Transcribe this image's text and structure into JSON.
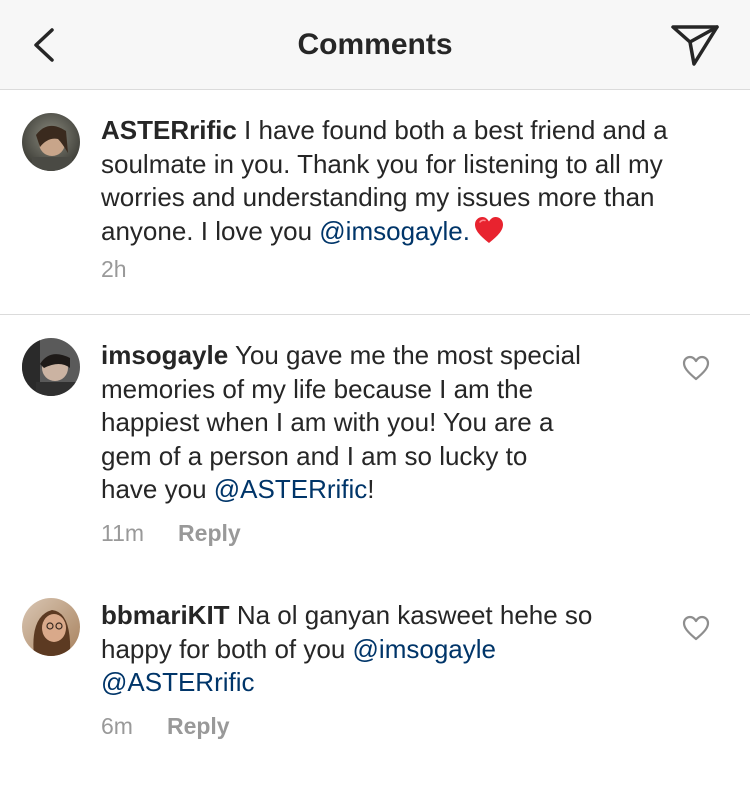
{
  "header": {
    "title": "Comments",
    "back_icon": "chevron-left-icon",
    "send_icon": "paper-plane-icon"
  },
  "caption": {
    "username": "ASTERrific",
    "text_1": "I have found both a best friend and a",
    "text_2": "soulmate in you. Thank you for listening to all my",
    "text_3": "worries and understanding my issues more than",
    "text_4": "anyone. I love you",
    "mention": "@imsogayle.",
    "emoji": "red-heart-emoji",
    "time": "2h"
  },
  "comments": [
    {
      "username": "imsogayle",
      "line_1": "You gave me the most special",
      "line_2": "memories of my life because I am the",
      "line_3": "happiest when I am with you! You are a",
      "line_4": "gem of a person and I am so lucky to",
      "line_5": "have you",
      "mention": "@ASTERrific",
      "after_mention": "!",
      "time": "11m",
      "reply_label": "Reply"
    },
    {
      "username": "bbmariKIT",
      "line_1": "Na ol ganyan kasweet hehe so",
      "line_2": "happy for both of you",
      "mention_1": "@imsogayle",
      "mention_2": "@ASTERrific",
      "time": "6m",
      "reply_label": "Reply"
    }
  ],
  "colors": {
    "text": "#262626",
    "mention": "#003569",
    "meta": "#999999",
    "divider": "#dbdbdb",
    "header_bg": "#f7f7f7"
  }
}
